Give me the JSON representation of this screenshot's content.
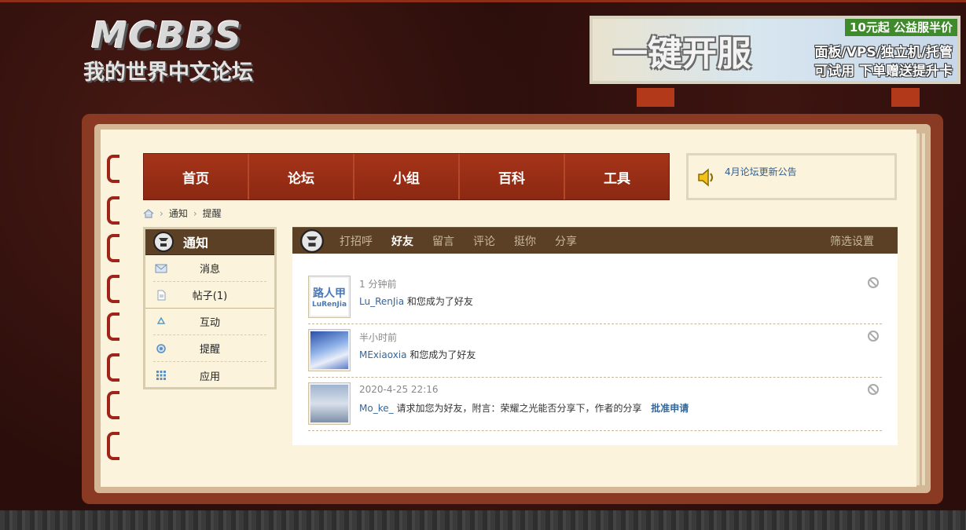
{
  "logo": {
    "main": "MCBBS",
    "sub": "我的世界中文论坛"
  },
  "ad": {
    "title": "一键开服",
    "tag": "10元起 公益服半价",
    "line1": "面板/VPS/独立机/托管",
    "line2": "可试用 下单赠送提升卡"
  },
  "nav": {
    "items": [
      "首页",
      "论坛",
      "小组",
      "百科",
      "工具"
    ]
  },
  "notice": {
    "text": "4月论坛更新公告"
  },
  "breadcrumb": {
    "items": [
      "通知",
      "提醒"
    ]
  },
  "sidebar": {
    "title": "通知",
    "items": [
      {
        "label": "消息",
        "icon": "envelope-icon"
      },
      {
        "label": "帖子(1)",
        "icon": "document-icon"
      },
      {
        "label": "互动",
        "icon": "recycle-icon"
      },
      {
        "label": "提醒",
        "icon": "gear-icon"
      },
      {
        "label": "应用",
        "icon": "grid-icon"
      }
    ]
  },
  "tabs": {
    "items": [
      "打招呼",
      "好友",
      "留言",
      "评论",
      "挺你",
      "分享"
    ],
    "active": "好友",
    "filter": "筛选设置"
  },
  "feed": [
    {
      "time": "1 分钟前",
      "user": "Lu_RenJia",
      "text": "和您成为了好友",
      "action": ""
    },
    {
      "time": "半小时前",
      "user": "MExiaoxia",
      "text": "和您成为了好友",
      "action": ""
    },
    {
      "time": "2020-4-25 22:16",
      "user": "Mo_ke_",
      "text": "请求加您为好友，附言：荣耀之光能否分享下，作者的分享",
      "action": "批准申请"
    }
  ],
  "colors": {
    "nav": "#8f2a14",
    "panel_head": "#5c4025",
    "link": "#336699",
    "page": "#fbf3dc"
  }
}
